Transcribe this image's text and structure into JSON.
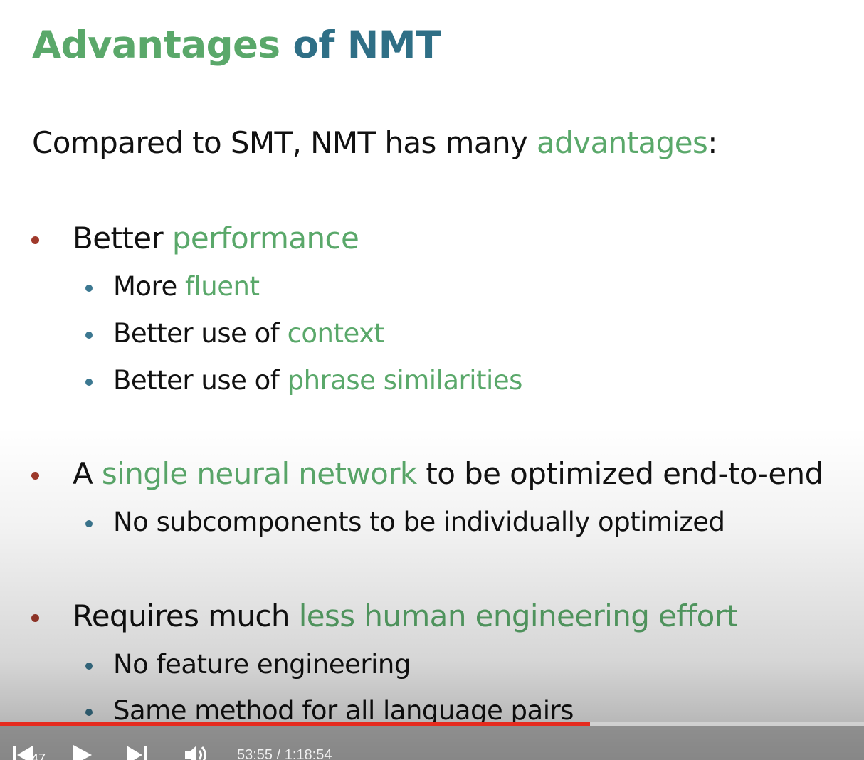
{
  "slide": {
    "title_part1": "Advantages",
    "title_part2": "of NMT",
    "intro_text": "Compared to SMT, NMT has many ",
    "intro_highlight": "advantages",
    "intro_end": ":",
    "bullets": [
      {
        "pre": "Better ",
        "highlight": "performance",
        "post": "",
        "sub": [
          {
            "pre": "More ",
            "highlight": "fluent"
          },
          {
            "pre": "Better use of ",
            "highlight": "context"
          },
          {
            "pre": "Better use of ",
            "highlight": "phrase similarities"
          }
        ]
      },
      {
        "pre": "A ",
        "highlight": "single neural network",
        "post": " to be optimized end-to-end",
        "sub": [
          {
            "text": "No subcomponents to be individually optimized"
          }
        ]
      },
      {
        "pre": "Requires much ",
        "highlight": "less human engineering effort",
        "post": "",
        "sub": [
          {
            "text": "No feature engineering"
          },
          {
            "text": "Same method for all language pairs"
          }
        ]
      }
    ]
  },
  "player": {
    "chapter_label": "47",
    "current_time": "53:55",
    "separator": " / ",
    "total_time": "1:18:54",
    "progress_fraction": 0.683,
    "icons": {
      "previous": "skip-previous-icon",
      "play": "play-icon",
      "next": "skip-next-icon",
      "volume": "volume-icon"
    },
    "colors": {
      "progress": "#e62b1e",
      "title_green": "#5aa86a",
      "title_blue": "#2f6f86",
      "highlight_green": "#5aa86a",
      "bullet_level1": "#a0392b",
      "bullet_level2": "#3c7891"
    }
  }
}
